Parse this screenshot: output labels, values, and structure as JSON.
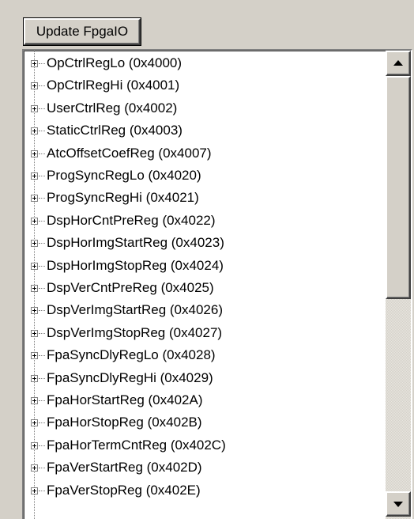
{
  "toolbar": {
    "update_label": "Update FpgaIO"
  },
  "tree": {
    "items": [
      {
        "label": "OpCtrlRegLo (0x4000)"
      },
      {
        "label": "OpCtrlRegHi (0x4001)"
      },
      {
        "label": "UserCtrlReg (0x4002)"
      },
      {
        "label": "StaticCtrlReg (0x4003)"
      },
      {
        "label": "AtcOffsetCoefReg (0x4007)"
      },
      {
        "label": "ProgSyncRegLo (0x4020)"
      },
      {
        "label": "ProgSyncRegHi (0x4021)"
      },
      {
        "label": "DspHorCntPreReg (0x4022)"
      },
      {
        "label": "DspHorImgStartReg (0x4023)"
      },
      {
        "label": "DspHorImgStopReg (0x4024)"
      },
      {
        "label": "DspVerCntPreReg (0x4025)"
      },
      {
        "label": "DspVerImgStartReg (0x4026)"
      },
      {
        "label": "DspVerImgStopReg (0x4027)"
      },
      {
        "label": "FpaSyncDlyRegLo (0x4028)"
      },
      {
        "label": "FpaSyncDlyRegHi (0x4029)"
      },
      {
        "label": "FpaHorStartReg (0x402A)"
      },
      {
        "label": "FpaHorStopReg (0x402B)"
      },
      {
        "label": "FpaHorTermCntReg (0x402C)"
      },
      {
        "label": "FpaVerStartReg (0x402D)"
      },
      {
        "label": "FpaVerStopReg (0x402E)"
      }
    ]
  },
  "scrollbar": {
    "up_icon": "arrow-up-icon",
    "down_icon": "arrow-down-icon"
  },
  "colors": {
    "face": "#d4d0c8",
    "window": "#ffffff",
    "text": "#000000"
  }
}
